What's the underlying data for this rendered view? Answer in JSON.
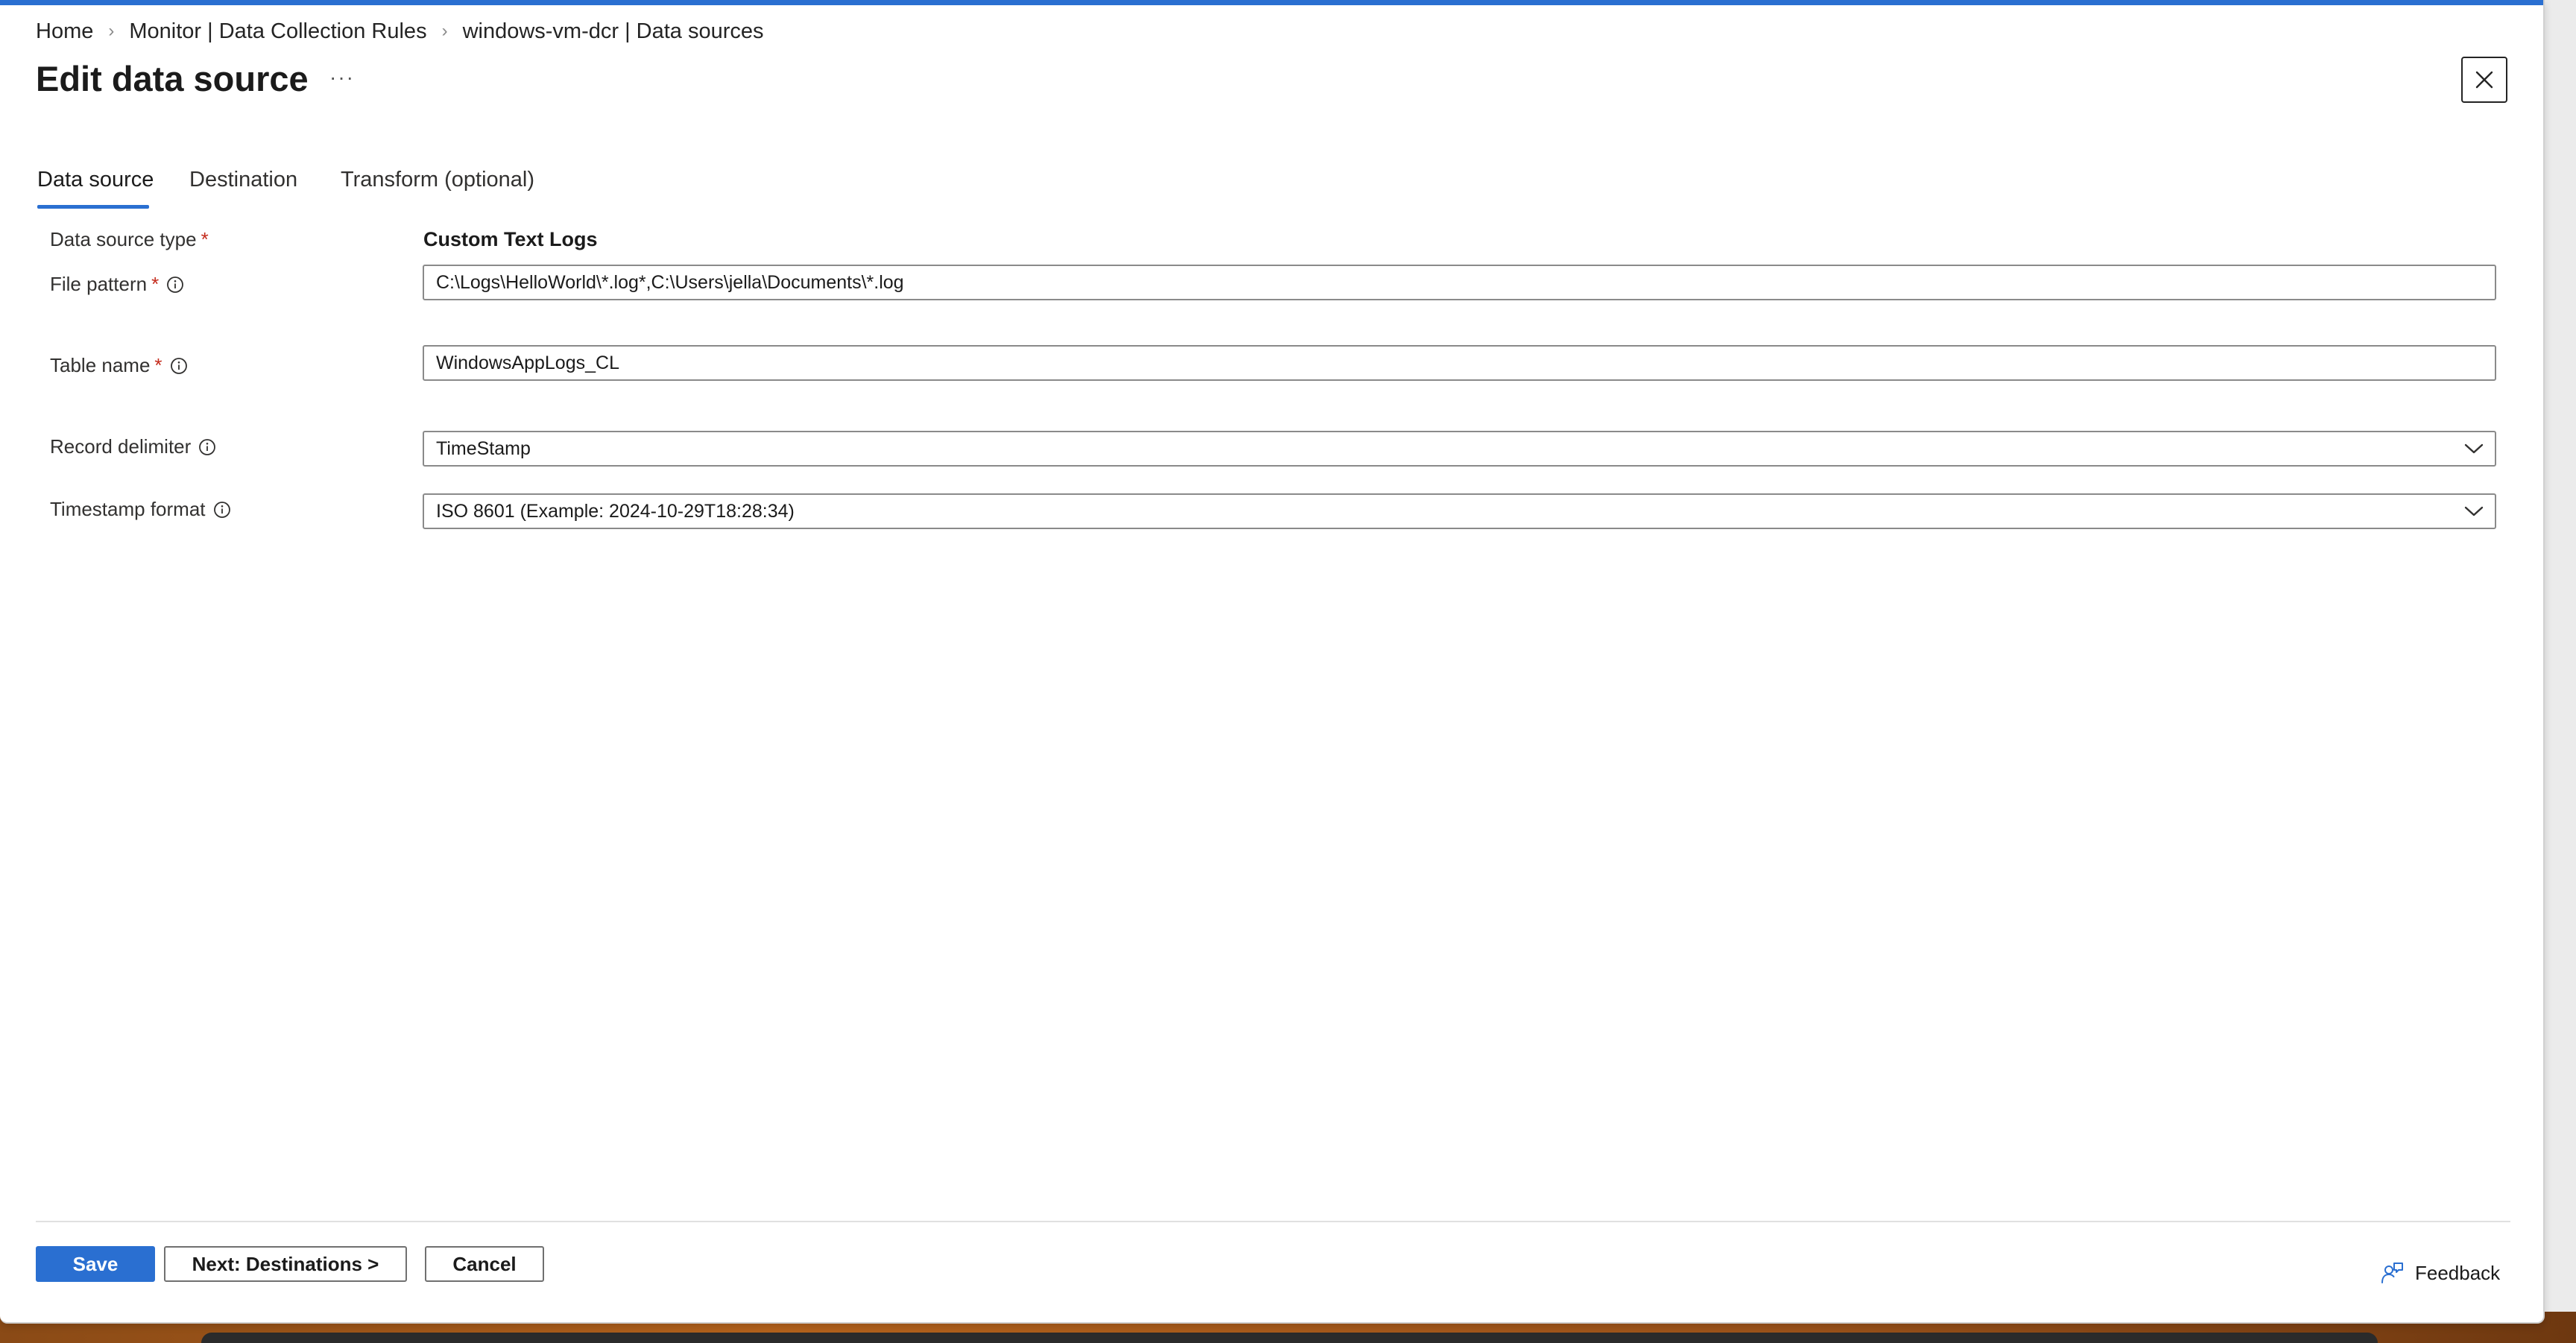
{
  "breadcrumb": {
    "items": [
      "Home",
      "Monitor | Data Collection Rules",
      "windows-vm-dcr | Data sources"
    ],
    "separator": "›"
  },
  "header": {
    "title": "Edit data source",
    "more_label": "···"
  },
  "tabs": [
    {
      "label": "Data source",
      "active": true
    },
    {
      "label": "Destination",
      "active": false
    },
    {
      "label": "Transform (optional)",
      "active": false
    }
  ],
  "form": {
    "data_source_type": {
      "label": "Data source type",
      "required": true,
      "value": "Custom Text Logs"
    },
    "file_pattern": {
      "label": "File pattern",
      "required": true,
      "value": "C:\\Logs\\HelloWorld\\*.log*,C:\\Users\\jella\\Documents\\*.log"
    },
    "table_name": {
      "label": "Table name",
      "required": true,
      "value": "WindowsAppLogs_CL"
    },
    "record_delimiter": {
      "label": "Record delimiter",
      "required": false,
      "value": "TimeStamp"
    },
    "timestamp_format": {
      "label": "Timestamp format",
      "required": false,
      "value": "ISO 8601 (Example: 2024-10-29T18:28:34)"
    },
    "required_marker": "*"
  },
  "footer": {
    "save_label": "Save",
    "next_label": "Next: Destinations >",
    "cancel_label": "Cancel",
    "feedback_label": "Feedback"
  },
  "icons": {
    "close": "close-icon",
    "info": "info-icon",
    "chevron": "chevron-down-icon",
    "feedback": "feedback-icon"
  },
  "colors": {
    "accent": "#2a6fd1",
    "required": "#c42b1c"
  }
}
